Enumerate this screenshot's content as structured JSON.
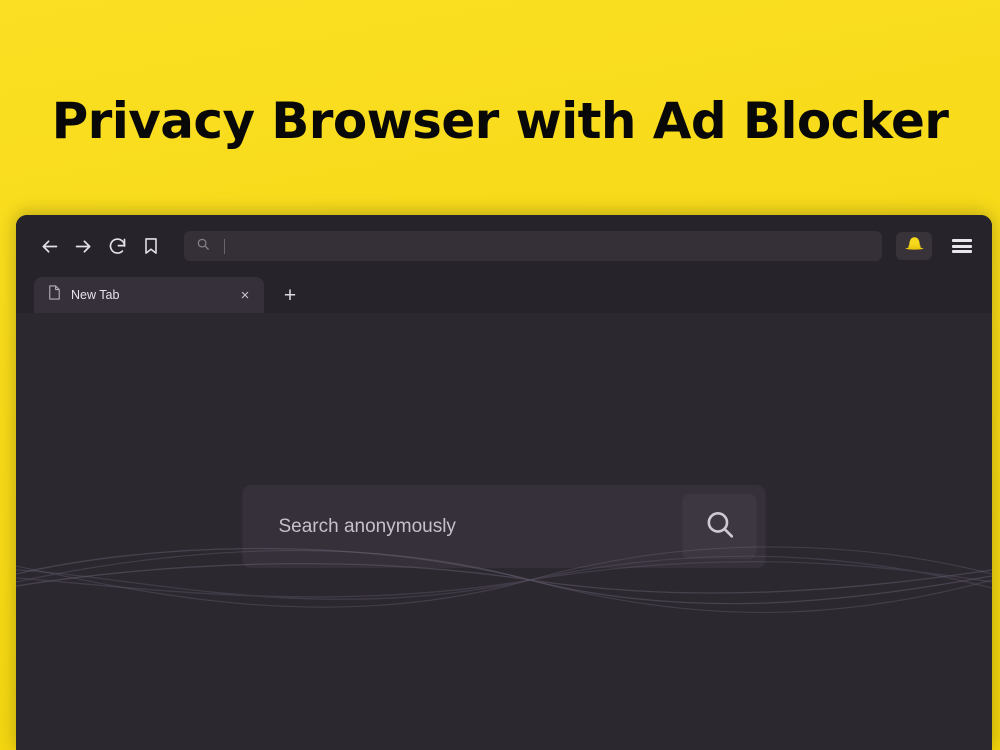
{
  "poster": {
    "headline": "Privacy Browser with Ad Blocker",
    "background_color": "#f8dc1c",
    "accent_color": "#f2d40c"
  },
  "browser": {
    "window_background": "#2a262c",
    "chrome_background": "#27232a",
    "content_background": "#2c2830",
    "toolbar": {
      "back_icon": "arrow-left-icon",
      "forward_icon": "arrow-right-icon",
      "reload_icon": "reload-icon",
      "bookmark_icon": "bookmark-icon",
      "privacy_icon": "privacy-hat-icon",
      "privacy_icon_color": "#f3d81a",
      "menu_icon": "hamburger-menu-icon"
    },
    "address_bar": {
      "icon": "search-icon",
      "value": "",
      "placeholder": ""
    },
    "tabs": [
      {
        "title": "New Tab",
        "favicon": "page-icon",
        "close_label": "×",
        "active": true
      }
    ],
    "new_tab_label": "+",
    "content": {
      "search": {
        "placeholder": "Search anonymously",
        "value": "",
        "button_icon": "search-icon"
      },
      "decoration": "wave-lines"
    }
  }
}
